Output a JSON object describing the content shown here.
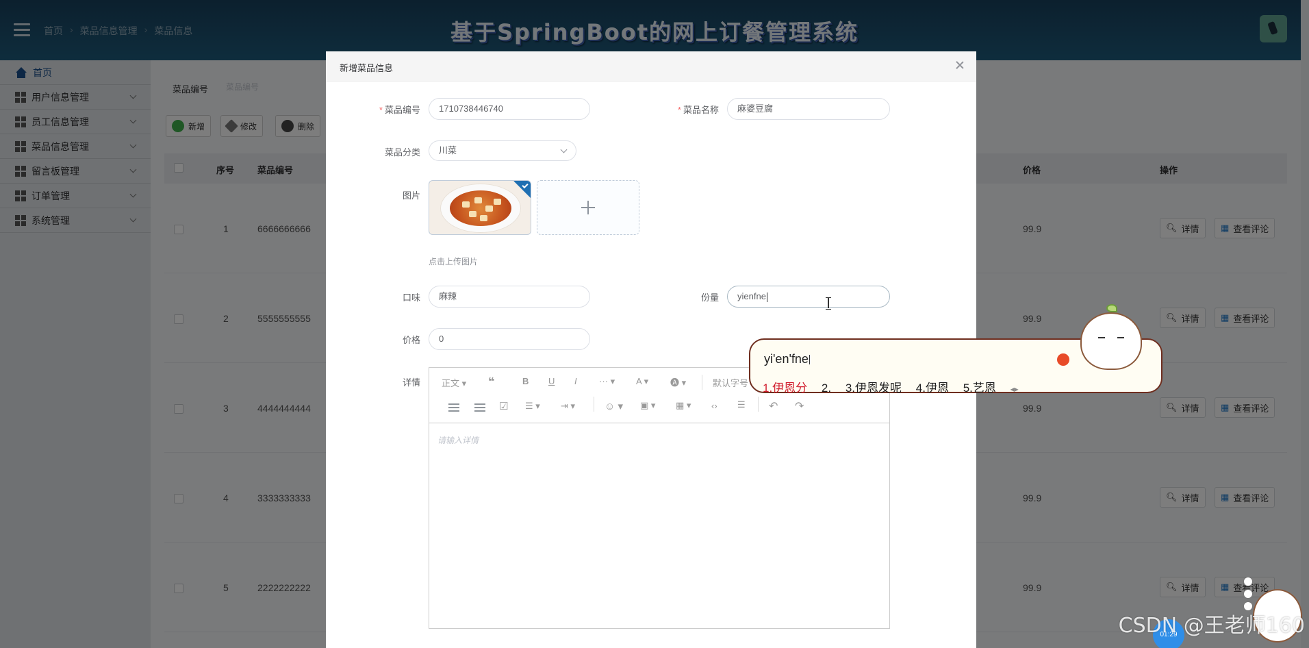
{
  "header": {
    "breadcrumb": [
      "首页",
      "菜品信息管理",
      "菜品信息"
    ],
    "title": "基于SpringBoot的网上订餐管理系统"
  },
  "sidebar": {
    "items": [
      {
        "label": "首页",
        "icon": "home-icon"
      },
      {
        "label": "用户信息管理",
        "icon": "grid-icon"
      },
      {
        "label": "员工信息管理",
        "icon": "grid-icon"
      },
      {
        "label": "菜品信息管理",
        "icon": "grid-icon"
      },
      {
        "label": "留言板管理",
        "icon": "grid-icon"
      },
      {
        "label": "订单管理",
        "icon": "grid-icon"
      },
      {
        "label": "系统管理",
        "icon": "grid-icon"
      }
    ]
  },
  "main": {
    "search_label": "菜品编号",
    "search_placeholder": "菜品编号",
    "toolbar": {
      "add": "新增",
      "edit": "修改",
      "delete": "删除"
    },
    "columns": {
      "index": "序号",
      "code": "菜品编号",
      "price": "价格",
      "ops": "操作"
    },
    "rows": [
      {
        "index": "1",
        "code": "6666666666",
        "price": "99.9"
      },
      {
        "index": "2",
        "code": "5555555555",
        "price": "99.9"
      },
      {
        "index": "3",
        "code": "4444444444",
        "price": "99.9"
      },
      {
        "index": "4",
        "code": "3333333333",
        "price": "99.9"
      },
      {
        "index": "5",
        "code": "2222222222",
        "price": "99.9"
      }
    ],
    "row_actions": {
      "detail": "详情",
      "comments": "查看评论"
    }
  },
  "dialog": {
    "title": "新增菜品信息",
    "fields": {
      "code_label": "菜品编号",
      "code_value": "1710738446740",
      "name_label": "菜品名称",
      "name_value": "麻婆豆腐",
      "category_label": "菜品分类",
      "category_value": "川菜",
      "image_label": "图片",
      "upload_tip": "点击上传图片",
      "taste_label": "口味",
      "taste_value": "麻辣",
      "portion_label": "份量",
      "portion_value": "yienfne",
      "price_label": "价格",
      "price_value": "0",
      "detail_label": "详情"
    },
    "editor": {
      "heading_select": "正文",
      "font_select": "默认字号",
      "placeholder": "请输入详情"
    }
  },
  "ime": {
    "input": "yi'en'fne",
    "candidates": [
      "1.伊恩分",
      "2.",
      "3.伊恩发呢",
      "4.伊恩",
      "5.艺恩"
    ]
  },
  "overlay_text": {
    "watermark": "CSDN @王老师160",
    "timer": "01:29"
  },
  "colors": {
    "header_bg": "#1d5a7a",
    "accent": "#1b4f8a",
    "required": "#f56c6c",
    "ime_highlight": "#d11e2d"
  }
}
